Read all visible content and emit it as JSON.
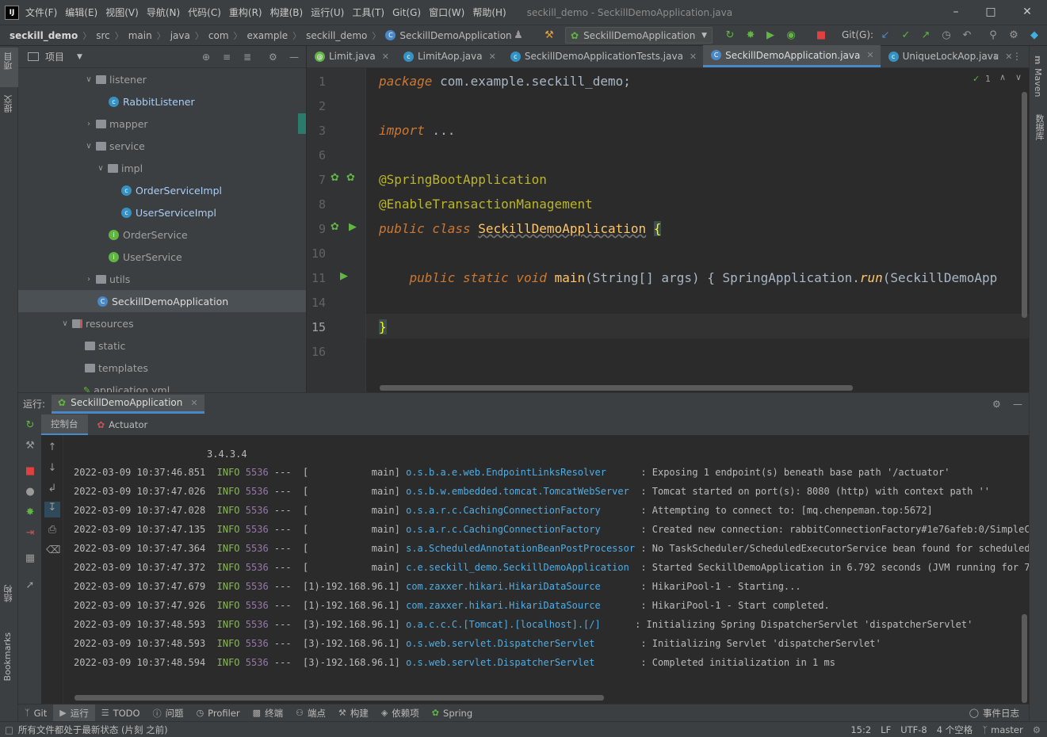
{
  "menubar": {
    "logo": "IJ",
    "items": [
      "文件(F)",
      "编辑(E)",
      "视图(V)",
      "导航(N)",
      "代码(C)",
      "重构(R)",
      "构建(B)",
      "运行(U)",
      "工具(T)",
      "Git(G)",
      "窗口(W)",
      "帮助(H)"
    ],
    "window_title": "seckill_demo - SeckillDemoApplication.java"
  },
  "breadcrumb": [
    "seckill_demo",
    "src",
    "main",
    "java",
    "com",
    "example",
    "seckill_demo",
    "SeckillDemoApplication"
  ],
  "toolbar": {
    "run_config": "SeckillDemoApplication",
    "git_label": "Git(G):"
  },
  "left_strip": {
    "project": "项目",
    "commit": "提交",
    "structure": "结构",
    "bookmarks": "Bookmarks"
  },
  "right_strip": {
    "maven": "Maven",
    "database": "数据库"
  },
  "project_panel": {
    "title": "项目"
  },
  "tree": [
    {
      "label": "listener",
      "kind": "folder",
      "depth": 3,
      "expanded": true
    },
    {
      "label": "RabbitListener",
      "kind": "class",
      "depth": 4
    },
    {
      "label": "mapper",
      "kind": "folder",
      "depth": 3,
      "expanded": false
    },
    {
      "label": "service",
      "kind": "folder",
      "depth": 3,
      "expanded": true
    },
    {
      "label": "impl",
      "kind": "folder",
      "depth": 4,
      "expanded": true
    },
    {
      "label": "OrderServiceImpl",
      "kind": "class",
      "depth": 5
    },
    {
      "label": "UserServiceImpl",
      "kind": "class",
      "depth": 5
    },
    {
      "label": "OrderService",
      "kind": "interface",
      "depth": 4
    },
    {
      "label": "UserService",
      "kind": "interface",
      "depth": 4
    },
    {
      "label": "utils",
      "kind": "folder",
      "depth": 3,
      "expanded": false
    },
    {
      "label": "SeckillDemoApplication",
      "kind": "app",
      "depth": 3,
      "selected": true
    },
    {
      "label": "resources",
      "kind": "resfolder",
      "depth": 2,
      "expanded": true
    },
    {
      "label": "static",
      "kind": "plainfolder",
      "depth": 3
    },
    {
      "label": "templates",
      "kind": "plainfolder",
      "depth": 3
    },
    {
      "label": "application.yml",
      "kind": "yml",
      "depth": 3
    }
  ],
  "tabs": [
    {
      "label": "Limit.java",
      "icon": "annotation-icon"
    },
    {
      "label": "LimitAop.java",
      "icon": "class-icon"
    },
    {
      "label": "SeckillDemoApplicationTests.java",
      "icon": "test-class-icon"
    },
    {
      "label": "SeckillDemoApplication.java",
      "icon": "app-icon",
      "active": true
    },
    {
      "label": "UniqueLockAop.java",
      "icon": "class-icon"
    }
  ],
  "editor": {
    "inspection_count": "1",
    "line_numbers": [
      "1",
      "2",
      "3",
      "6",
      "7",
      "8",
      "9",
      "10",
      "11",
      "14",
      "15",
      "16"
    ],
    "current_line": "15"
  },
  "run_panel": {
    "label": "运行:",
    "tab": "SeckillDemoApplication",
    "console_tab": "控制台",
    "actuator_tab": "Actuator",
    "banner_version": "3.4.3.4"
  },
  "console": [
    {
      "ts": "2022-03-09 10:37:46.851",
      "level": "INFO",
      "pid": "5536",
      "thread": "---  [           main]",
      "logger": "o.s.b.a.e.web.EndpointLinksResolver     ",
      "msg": ": Exposing 1 endpoint(s) beneath base path '/actuator'"
    },
    {
      "ts": "2022-03-09 10:37:47.026",
      "level": "INFO",
      "pid": "5536",
      "thread": "---  [           main]",
      "logger": "o.s.b.w.embedded.tomcat.TomcatWebServer ",
      "msg": ": Tomcat started on port(s): 8080 (http) with context path ''"
    },
    {
      "ts": "2022-03-09 10:37:47.028",
      "level": "INFO",
      "pid": "5536",
      "thread": "---  [           main]",
      "logger": "o.s.a.r.c.CachingConnectionFactory      ",
      "msg": ": Attempting to connect to: [mq.chenpeman.top:5672]"
    },
    {
      "ts": "2022-03-09 10:37:47.135",
      "level": "INFO",
      "pid": "5536",
      "thread": "---  [           main]",
      "logger": "o.s.a.r.c.CachingConnectionFactory      ",
      "msg": ": Created new connection: rabbitConnectionFactory#1e76afeb:0/SimpleConnec"
    },
    {
      "ts": "2022-03-09 10:37:47.364",
      "level": "INFO",
      "pid": "5536",
      "thread": "---  [           main]",
      "logger": "s.a.ScheduledAnnotationBeanPostProcessor",
      "msg": ": No TaskScheduler/ScheduledExecutorService bean found for scheduled proc"
    },
    {
      "ts": "2022-03-09 10:37:47.372",
      "level": "INFO",
      "pid": "5536",
      "thread": "---  [           main]",
      "logger": "c.e.seckill_demo.SeckillDemoApplication ",
      "msg": ": Started SeckillDemoApplication in 6.792 seconds (JVM running for 7.854)"
    },
    {
      "ts": "2022-03-09 10:37:47.679",
      "level": "INFO",
      "pid": "5536",
      "thread": "---  [1)-192.168.96.1]",
      "logger": "com.zaxxer.hikari.HikariDataSource      ",
      "msg": ": HikariPool-1 - Starting..."
    },
    {
      "ts": "2022-03-09 10:37:47.926",
      "level": "INFO",
      "pid": "5536",
      "thread": "---  [1)-192.168.96.1]",
      "logger": "com.zaxxer.hikari.HikariDataSource      ",
      "msg": ": HikariPool-1 - Start completed."
    },
    {
      "ts": "2022-03-09 10:37:48.593",
      "level": "INFO",
      "pid": "5536",
      "thread": "---  [3)-192.168.96.1]",
      "logger": "o.a.c.c.C.[Tomcat].[localhost].[/]     ",
      "msg": ": Initializing Spring DispatcherServlet 'dispatcherServlet'"
    },
    {
      "ts": "2022-03-09 10:37:48.593",
      "level": "INFO",
      "pid": "5536",
      "thread": "---  [3)-192.168.96.1]",
      "logger": "o.s.web.servlet.DispatcherServlet       ",
      "msg": ": Initializing Servlet 'dispatcherServlet'"
    },
    {
      "ts": "2022-03-09 10:37:48.594",
      "level": "INFO",
      "pid": "5536",
      "thread": "---  [3)-192.168.96.1]",
      "logger": "o.s.web.servlet.DispatcherServlet       ",
      "msg": ": Completed initialization in 1 ms"
    }
  ],
  "bottom_tabs": [
    {
      "label": "Git",
      "icon": "git-icon"
    },
    {
      "label": "运行",
      "icon": "run-icon",
      "active": true
    },
    {
      "label": "TODO",
      "icon": "todo-icon"
    },
    {
      "label": "问题",
      "icon": "problems-icon"
    },
    {
      "label": "Profiler",
      "icon": "profiler-icon"
    },
    {
      "label": "终端",
      "icon": "terminal-icon"
    },
    {
      "label": "端点",
      "icon": "endpoints-icon"
    },
    {
      "label": "构建",
      "icon": "build-icon"
    },
    {
      "label": "依赖项",
      "icon": "dependencies-icon"
    },
    {
      "label": "Spring",
      "icon": "spring-icon"
    }
  ],
  "event_log": "事件日志",
  "status": {
    "message": "所有文件都处于最新状态 (片刻 之前)",
    "position": "15:2",
    "line_sep": "LF",
    "encoding": "UTF-8",
    "indent": "4 个空格",
    "branch": "master"
  },
  "colors": {
    "accent": "#4a88c7",
    "keyword": "#cc7832",
    "annotation": "#bbb529",
    "class_name": "#ffc66d",
    "log_level": "#8ab55c",
    "log_pid": "#9876aa",
    "logger": "#4eade5"
  }
}
